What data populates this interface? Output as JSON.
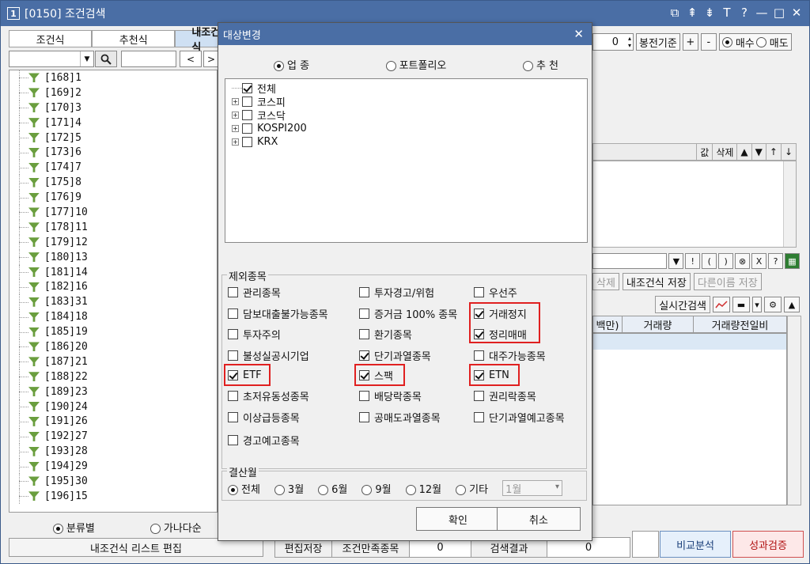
{
  "window": {
    "number": "1",
    "title": "[0150] 조건검색",
    "controls": [
      "⧉",
      "⇞",
      "⇟",
      "T",
      "?",
      "—",
      "□",
      "✕"
    ]
  },
  "left": {
    "tabs": [
      "조건식",
      "추천식",
      "내조건식"
    ],
    "nav_prev": "<",
    "nav_next": ">",
    "tree_items": [
      "[168]1",
      "[169]2",
      "[170]3",
      "[171]4",
      "[172]5",
      "[173]6",
      "[174]7",
      "[175]8",
      "[176]9",
      "[177]10",
      "[178]11",
      "[179]12",
      "[180]13",
      "[181]14",
      "[182]16",
      "[183]31",
      "[184]18",
      "[185]19",
      "[186]20",
      "[187]21",
      "[188]22",
      "[189]23",
      "[190]24",
      "[191]26",
      "[192]27",
      "[193]28",
      "[194]29",
      "[195]30",
      "[196]15"
    ],
    "sort_by_category": "분류별",
    "sort_by_name": "가나다순",
    "edit_list": "내조건식 리스트 편집"
  },
  "right": {
    "spin_value": "0",
    "bong_label": "봉전기준",
    "plus": "+",
    "minus": "-",
    "buy": "매수",
    "sell": "매도",
    "header": [
      "값",
      "삭제",
      "▲",
      "▼",
      "↑",
      "↓"
    ],
    "icons": [
      "▼",
      "!",
      "(",
      ")",
      "⊗",
      "X",
      "?"
    ],
    "delete_label": "삭제",
    "save_label": "내조건식 저장",
    "save_as_label": "다른이름 저장",
    "realtime_label": "실시간검색",
    "grid_cols": [
      "백만)",
      "거래량",
      "거래량전일비"
    ],
    "bottom": {
      "save_label": "편집저장",
      "satisfy_label": "조건만족종목",
      "satisfy_value": "0",
      "result_label": "검색결과",
      "result_value": "0"
    },
    "compare": "비교분석",
    "performance": "성과검증"
  },
  "dialog": {
    "title": "대상변경",
    "close": "✕",
    "target_options": [
      "업 종",
      "포트폴리오",
      "추 천"
    ],
    "tree": [
      {
        "label": "전체",
        "checked": true
      },
      {
        "label": "코스피",
        "checked": false
      },
      {
        "label": "코스닥",
        "checked": false
      },
      {
        "label": "KOSPI200",
        "checked": false
      },
      {
        "label": "KRX",
        "checked": false
      }
    ],
    "exclude_title": "제외종목",
    "exclude_items": [
      {
        "label": "관리종목",
        "checked": false
      },
      {
        "label": "투자경고/위험",
        "checked": false
      },
      {
        "label": "우선주",
        "checked": false
      },
      {
        "label": "담보대출불가능종목",
        "checked": false
      },
      {
        "label": "증거금 100% 종목",
        "checked": false
      },
      {
        "label": "거래정지",
        "checked": true
      },
      {
        "label": "투자주의",
        "checked": false
      },
      {
        "label": "환기종목",
        "checked": false
      },
      {
        "label": "정리매매",
        "checked": true
      },
      {
        "label": "불성실공시기업",
        "checked": false
      },
      {
        "label": "단기과열종목",
        "checked": true
      },
      {
        "label": "대주가능종목",
        "checked": false
      },
      {
        "label": "ETF",
        "checked": true
      },
      {
        "label": "스팩",
        "checked": true
      },
      {
        "label": "ETN",
        "checked": true
      },
      {
        "label": "초저유동성종목",
        "checked": false
      },
      {
        "label": "배당락종목",
        "checked": false
      },
      {
        "label": "권리락종목",
        "checked": false
      },
      {
        "label": "이상급등종목",
        "checked": false
      },
      {
        "label": "공매도과열종목",
        "checked": false
      },
      {
        "label": "단기과열예고종목",
        "checked": false
      },
      {
        "label": "경고예고종목",
        "checked": false
      }
    ],
    "settle_title": "결산월",
    "settle_options": [
      "전체",
      "3월",
      "6월",
      "9월",
      "12월",
      "기타"
    ],
    "settle_month": "1월",
    "ok": "확인",
    "cancel": "취소"
  }
}
